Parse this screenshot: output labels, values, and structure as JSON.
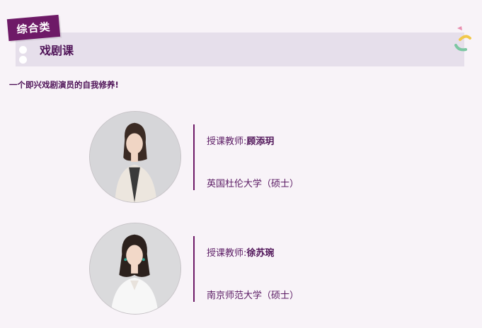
{
  "header": {
    "category": "综合类",
    "course_title": "戏剧课"
  },
  "subtitle": "一个即兴戏剧演员的自我修养!",
  "teachers": [
    {
      "label": "授课教师:",
      "name": "顾添玥",
      "education": "英国杜伦大学（硕士）"
    },
    {
      "label": "授课教师:",
      "name": "徐苏琬",
      "education": "南京师范大学（硕士）"
    }
  ],
  "colors": {
    "accent": "#6e1a67",
    "band": "#e6dfeb",
    "background": "#f8f3f8"
  }
}
